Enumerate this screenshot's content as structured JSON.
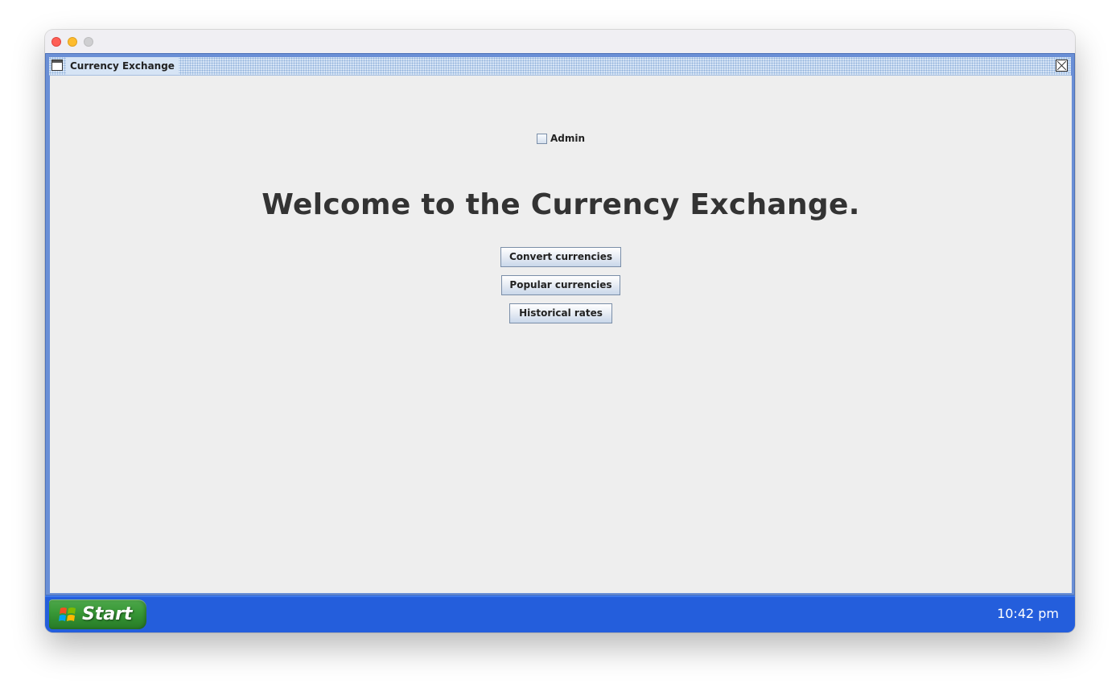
{
  "internal_frame": {
    "title": "Currency Exchange"
  },
  "main": {
    "admin_checkbox": {
      "label": "Admin",
      "checked": false
    },
    "welcome_text": "Welcome to the Currency Exchange.",
    "buttons": {
      "convert": "Convert currencies",
      "popular": "Popular currencies",
      "historical": "Historical rates"
    }
  },
  "taskbar": {
    "start_label": "Start",
    "clock": "10:42 pm"
  },
  "icons": {
    "window": "window-icon",
    "close": "close-icon",
    "start": "windows-logo-icon"
  },
  "colors": {
    "taskbar": "#245edc",
    "start_button": "#3a9a38",
    "frame_border": "#6a8fd6"
  }
}
